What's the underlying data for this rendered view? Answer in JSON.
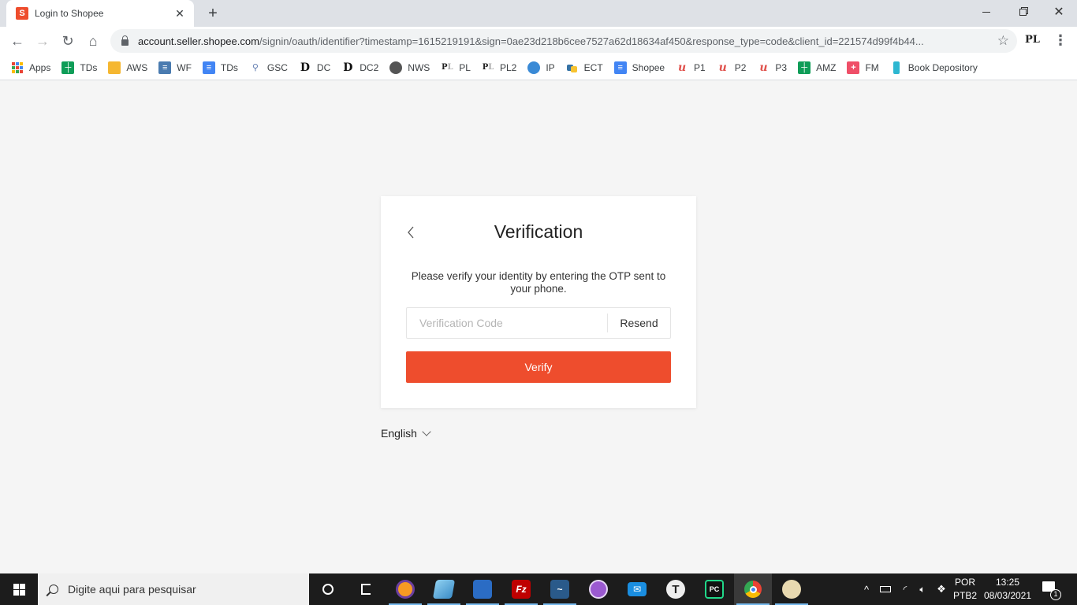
{
  "browser": {
    "tab": {
      "title": "Login to Shopee",
      "favicon": "shopee-bag-icon",
      "favicon_letter": "S"
    },
    "new_tab_label": "+",
    "window_controls": {
      "minimize": "—",
      "restore": "❐",
      "close": "✕"
    },
    "url": {
      "host": "account.seller.shopee.com",
      "path": "/signin/oauth/identifier?timestamp=1615219191&sign=0ae23d218b6cee7527a62d18634af450&response_type=code&client_id=221574d99f4b44..."
    },
    "extension_label": "PL",
    "bookmarks": [
      {
        "label": "Apps",
        "icon": "apps-grid-icon"
      },
      {
        "label": "TDs",
        "icon": "google-sheets-icon"
      },
      {
        "label": "AWS",
        "icon": "aws-box-icon"
      },
      {
        "label": "WF",
        "icon": "forms-icon"
      },
      {
        "label": "TDs",
        "icon": "google-docs-icon"
      },
      {
        "label": "GSC",
        "icon": "search-console-icon"
      },
      {
        "label": "DC",
        "icon": "d-letter-icon"
      },
      {
        "label": "DC2",
        "icon": "d-letter-icon"
      },
      {
        "label": "NWS",
        "icon": "globe-icon"
      },
      {
        "label": "PL",
        "icon": "pl-icon"
      },
      {
        "label": "PL2",
        "icon": "pl-icon"
      },
      {
        "label": "IP",
        "icon": "earth-icon"
      },
      {
        "label": "ECT",
        "icon": "python-icon"
      },
      {
        "label": "Shopee",
        "icon": "google-docs-icon"
      },
      {
        "label": "P1",
        "icon": "u-logo-icon"
      },
      {
        "label": "P2",
        "icon": "u-logo-icon"
      },
      {
        "label": "P3",
        "icon": "u-logo-icon"
      },
      {
        "label": "AMZ",
        "icon": "google-sheets-icon"
      },
      {
        "label": "FM",
        "icon": "plus-cross-icon"
      },
      {
        "label": "Book Depository",
        "icon": "book-icon"
      }
    ]
  },
  "verification": {
    "title": "Verification",
    "description": "Please verify your identity by entering the OTP sent to your phone.",
    "code_input": {
      "value": "",
      "placeholder": "Verification Code"
    },
    "resend_label": "Resend",
    "verify_label": "Verify",
    "language": "English"
  },
  "colors": {
    "accent": "#ee4d2d",
    "page_bg": "#f5f5f5"
  },
  "taskbar": {
    "search_placeholder": "Digite aqui para pesquisar",
    "apps": [
      {
        "name": "cortana",
        "icon": "cortana-ring-icon"
      },
      {
        "name": "task-view",
        "icon": "task-view-icon"
      },
      {
        "name": "vpn-shield",
        "icon": "shield-icon"
      },
      {
        "name": "notepad",
        "icon": "notepad-icon"
      },
      {
        "name": "remote-desktop",
        "icon": "remote-desktop-icon"
      },
      {
        "name": "filezilla",
        "icon": "filezilla-icon",
        "letter": "Fz"
      },
      {
        "name": "mysql-workbench",
        "icon": "mysql-dolphin-icon"
      },
      {
        "name": "github-desktop",
        "icon": "github-cat-icon"
      },
      {
        "name": "mail",
        "icon": "mail-icon"
      },
      {
        "name": "typora",
        "icon": "t-circle-icon",
        "letter": "T"
      },
      {
        "name": "pycharm",
        "icon": "pycharm-icon",
        "letter": "PC"
      },
      {
        "name": "chrome",
        "icon": "chrome-icon"
      },
      {
        "name": "paint",
        "icon": "paint-palette-icon"
      }
    ],
    "tray": {
      "language_line1": "POR",
      "language_line2": "PTB2",
      "time": "13:25",
      "date": "08/03/2021",
      "notification_count": "1"
    }
  }
}
